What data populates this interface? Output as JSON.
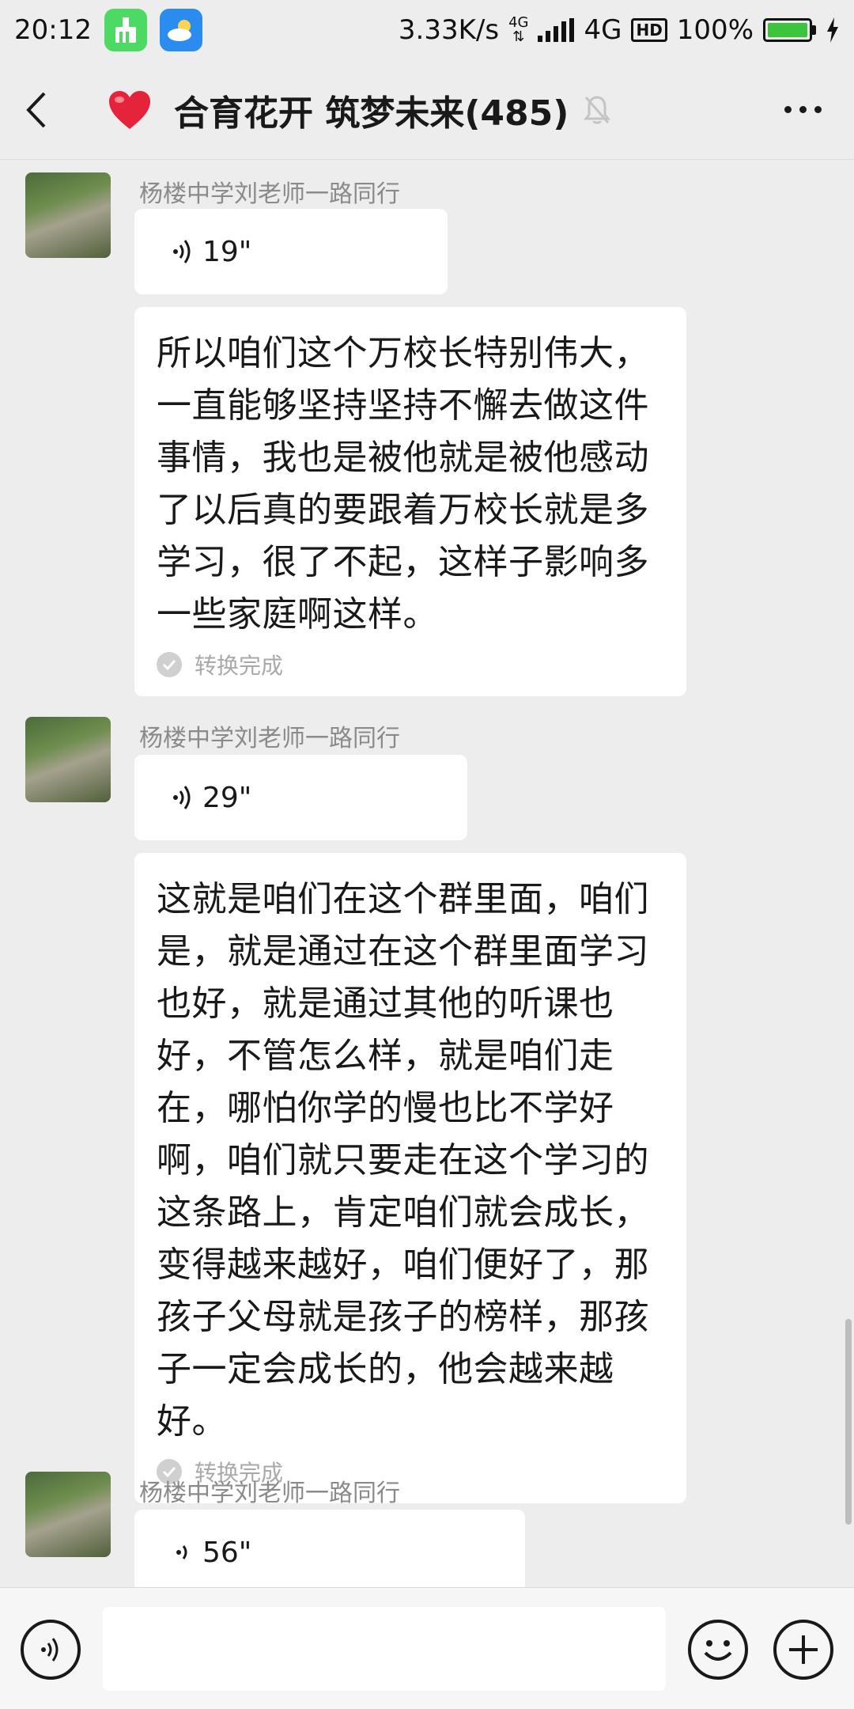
{
  "status_bar": {
    "time": "20:12",
    "net_speed": "3.33K/s",
    "net_type_small": "4G",
    "net_type": "4G",
    "hd": "HD",
    "battery": "100%",
    "battery_level": 1.0,
    "icons": [
      "cleaner-app-icon",
      "weather-app-icon",
      "signal-icon",
      "battery-icon",
      "charging-icon"
    ]
  },
  "header": {
    "title": "合育花开 筑梦未来(485)",
    "icons": [
      "back-arrow-icon",
      "heart-icon",
      "mute-bell-icon",
      "more-icon"
    ]
  },
  "messages": [
    {
      "sender": "杨楼中学刘老师一路同行",
      "voice_duration": "19\"",
      "transcript": "所以咱们这个万校长特别伟大，一直能够坚持坚持不懈去做这件事情，我也是被他就是被他感动了以后真的要跟着万校长就是多学习，很了不起，这样子影响多一些家庭啊这样。",
      "status": "转换完成"
    },
    {
      "sender": "杨楼中学刘老师一路同行",
      "voice_duration": "29\"",
      "transcript": "这就是咱们在这个群里面，咱们是，就是通过在这个群里面学习也好，就是通过其他的听课也好，不管怎么样，就是咱们走在，哪怕你学的慢也比不学好啊，咱们就只要走在这个学习的这条路上，肯定咱们就会成长，变得越来越好，咱们便好了，那孩子父母就是孩子的榜样，那孩子一定会成长的，他会越来越好。",
      "status": "转换完成"
    },
    {
      "sender": "杨楼中学刘老师一路同行",
      "voice_duration": "56\""
    }
  ],
  "input_bar": {
    "icons": [
      "voice-mode-icon",
      "emoji-icon",
      "plus-icon"
    ]
  },
  "colors": {
    "background": "#ededed",
    "bubble": "#ffffff",
    "battery_fill": "#3cc43c",
    "heart": "#e5243b"
  }
}
